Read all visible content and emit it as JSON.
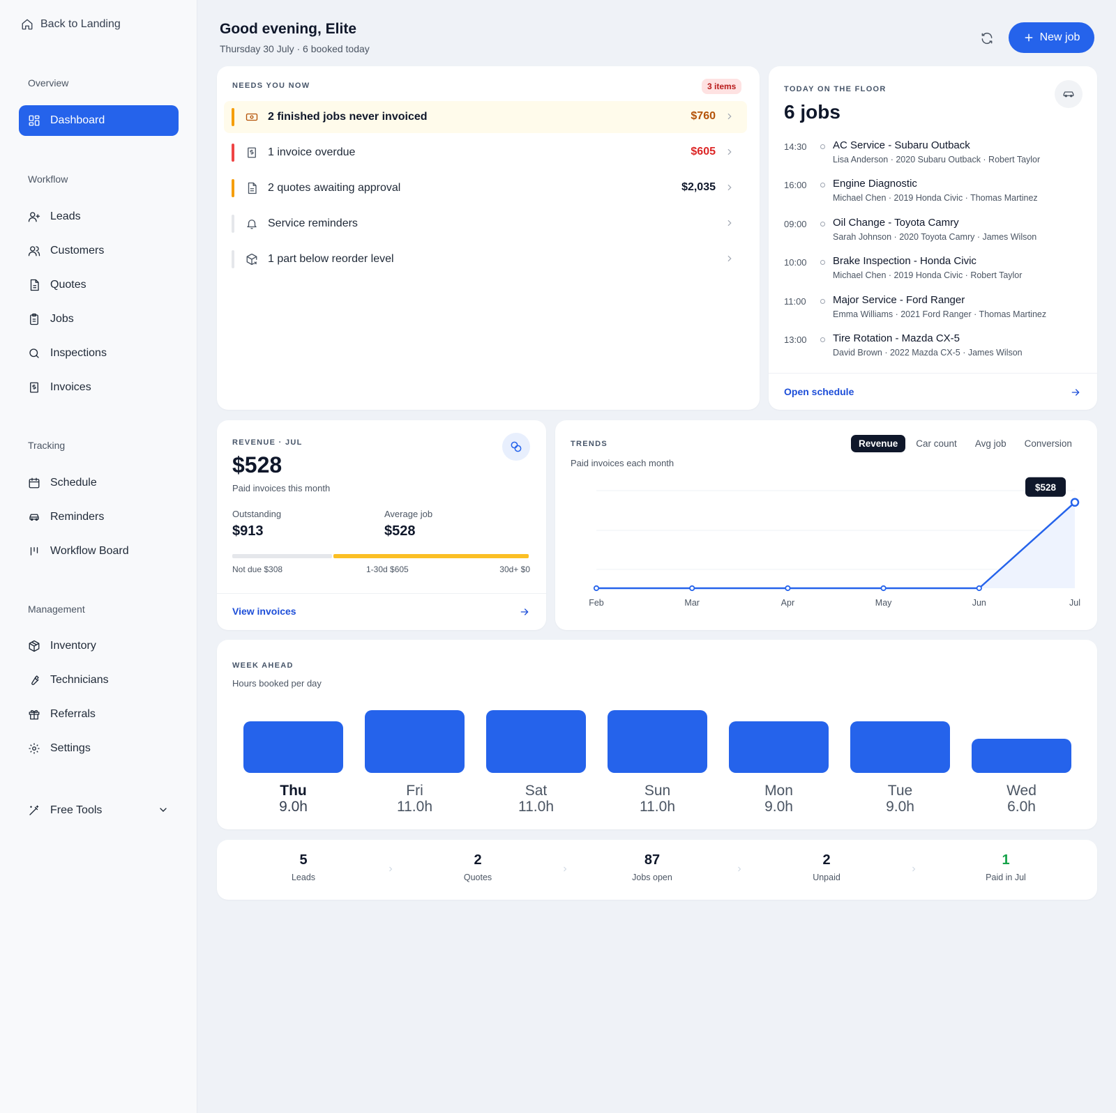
{
  "sidebar": {
    "back_label": "Back to Landing",
    "sections": {
      "overview": "Overview",
      "workflow": "Workflow",
      "tracking": "Tracking",
      "management": "Management"
    },
    "items": {
      "dashboard": "Dashboard",
      "leads": "Leads",
      "customers": "Customers",
      "quotes": "Quotes",
      "jobs": "Jobs",
      "inspections": "Inspections",
      "invoices": "Invoices",
      "schedule": "Schedule",
      "reminders": "Reminders",
      "workflow_board": "Workflow Board",
      "inventory": "Inventory",
      "technicians": "Technicians",
      "referrals": "Referrals",
      "settings": "Settings",
      "free_tools": "Free Tools"
    }
  },
  "header": {
    "title": "Good evening, Elite",
    "subtitle": "Thursday 30 July · 6 booked today",
    "new_job_label": "New job"
  },
  "needs": {
    "title": "NEEDS YOU NOW",
    "badge": "3 items",
    "rows": [
      {
        "label": "2 finished jobs never invoiced",
        "amount": "$760",
        "icon": "cash-icon"
      },
      {
        "label": "1 invoice overdue",
        "amount": "$605",
        "icon": "invoice-icon"
      },
      {
        "label": "2 quotes awaiting approval",
        "amount": "$2,035",
        "icon": "document-icon"
      },
      {
        "label": "Service reminders",
        "amount": "",
        "icon": "bell-icon"
      },
      {
        "label": "1 part below reorder level",
        "amount": "",
        "icon": "package-x-icon"
      }
    ],
    "colors": {
      "orange": "#f59e0b",
      "red": "#ef4444",
      "gray": "#e5e7eb",
      "amount_orange": "#b45309",
      "amount_red": "#dc2626"
    }
  },
  "floor": {
    "title": "TODAY ON THE FLOOR",
    "count": "6 jobs",
    "jobs": [
      {
        "time": "14:30",
        "title": "AC Service - Subaru Outback",
        "sub": "Lisa Anderson · 2020 Subaru Outback · Robert Taylor"
      },
      {
        "time": "16:00",
        "title": "Engine Diagnostic",
        "sub": "Michael Chen · 2019 Honda Civic · Thomas Martinez"
      },
      {
        "time": "09:00",
        "title": "Oil Change - Toyota Camry",
        "sub": "Sarah Johnson · 2020 Toyota Camry · James Wilson"
      },
      {
        "time": "10:00",
        "title": "Brake Inspection - Honda Civic",
        "sub": "Michael Chen · 2019 Honda Civic · Robert Taylor"
      },
      {
        "time": "11:00",
        "title": "Major Service - Ford Ranger",
        "sub": "Emma Williams · 2021 Ford Ranger · Thomas Martinez"
      },
      {
        "time": "13:00",
        "title": "Tire Rotation - Mazda CX-5",
        "sub": "David Brown · 2022 Mazda CX-5 · James Wilson"
      }
    ],
    "link": "Open schedule"
  },
  "revenue": {
    "title": "REVENUE · JUL",
    "amount": "$528",
    "subtitle": "Paid invoices this month",
    "outstanding_label": "Outstanding",
    "outstanding_value": "$913",
    "average_label": "Average job",
    "average_value": "$528",
    "aging": [
      {
        "label": "Not due $308",
        "value": 308,
        "color": "#e5e7eb"
      },
      {
        "label": "1-30d $605",
        "value": 605,
        "color": "#fbbf24"
      },
      {
        "label": "30d+ $0",
        "value": 0,
        "color": "#ef4444"
      }
    ],
    "link": "View invoices"
  },
  "trends": {
    "title": "TRENDS",
    "subtitle": "Paid invoices each month",
    "tabs": [
      "Revenue",
      "Car count",
      "Avg job",
      "Conversion"
    ],
    "active_tab": "Revenue"
  },
  "chart_data": {
    "type": "area",
    "x": [
      "Feb",
      "Mar",
      "Apr",
      "May",
      "Jun",
      "Jul"
    ],
    "series": [
      {
        "values": [
          0,
          0,
          0,
          0,
          0,
          528
        ]
      }
    ],
    "callout": "$528",
    "ylim": [
      0,
      600
    ],
    "grid": true,
    "color": "#2563eb"
  },
  "week": {
    "title": "WEEK AHEAD",
    "subtitle": "Hours booked per day",
    "days": [
      {
        "name": "Thu",
        "hours": 9.0,
        "label": "9.0h",
        "today": true
      },
      {
        "name": "Fri",
        "hours": 11.0,
        "label": "11.0h"
      },
      {
        "name": "Sat",
        "hours": 11.0,
        "label": "11.0h"
      },
      {
        "name": "Sun",
        "hours": 11.0,
        "label": "11.0h"
      },
      {
        "name": "Mon",
        "hours": 9.0,
        "label": "9.0h"
      },
      {
        "name": "Tue",
        "hours": 9.0,
        "label": "9.0h"
      },
      {
        "name": "Wed",
        "hours": 6.0,
        "label": "6.0h"
      }
    ]
  },
  "funnel": [
    {
      "num": "5",
      "label": "Leads"
    },
    {
      "num": "2",
      "label": "Quotes"
    },
    {
      "num": "87",
      "label": "Jobs open"
    },
    {
      "num": "2",
      "label": "Unpaid"
    },
    {
      "num": "1",
      "label": "Paid in Jul",
      "color": "#16a34a"
    }
  ]
}
